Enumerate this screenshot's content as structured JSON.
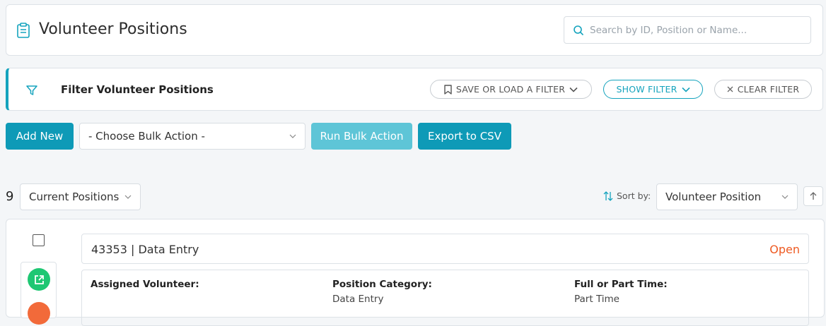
{
  "header": {
    "title": "Volunteer Positions",
    "title_icon": "clipboard-icon",
    "search": {
      "placeholder": "Search by ID, Position or Name...",
      "value": ""
    }
  },
  "filter_bar": {
    "title": "Filter Volunteer Positions",
    "save_load_label": "SAVE OR LOAD A FILTER",
    "show_filter_label": "SHOW FILTER",
    "clear_filter_label": "CLEAR FILTER"
  },
  "actions": {
    "add_new": "Add New",
    "bulk_action_selected": "- Choose Bulk Action -",
    "run_bulk": "Run Bulk Action",
    "export_csv": "Export to CSV"
  },
  "results": {
    "count": "9",
    "view_selected": "Current Positions",
    "sort_label": "Sort by:",
    "sort_selected": "Volunteer Position"
  },
  "record": {
    "title": "43353 | Data Entry",
    "status": "Open",
    "fields": [
      {
        "label": "Assigned Volunteer:",
        "value": ""
      },
      {
        "label": "Position Category:",
        "value": "Data Entry"
      },
      {
        "label": "Full or Part Time:",
        "value": "Part Time"
      }
    ]
  },
  "colors": {
    "accent": "#0e9ab7",
    "accent_light": "#5ec5d7",
    "status_open": "#ee5a22",
    "link_green": "#1ec773"
  }
}
